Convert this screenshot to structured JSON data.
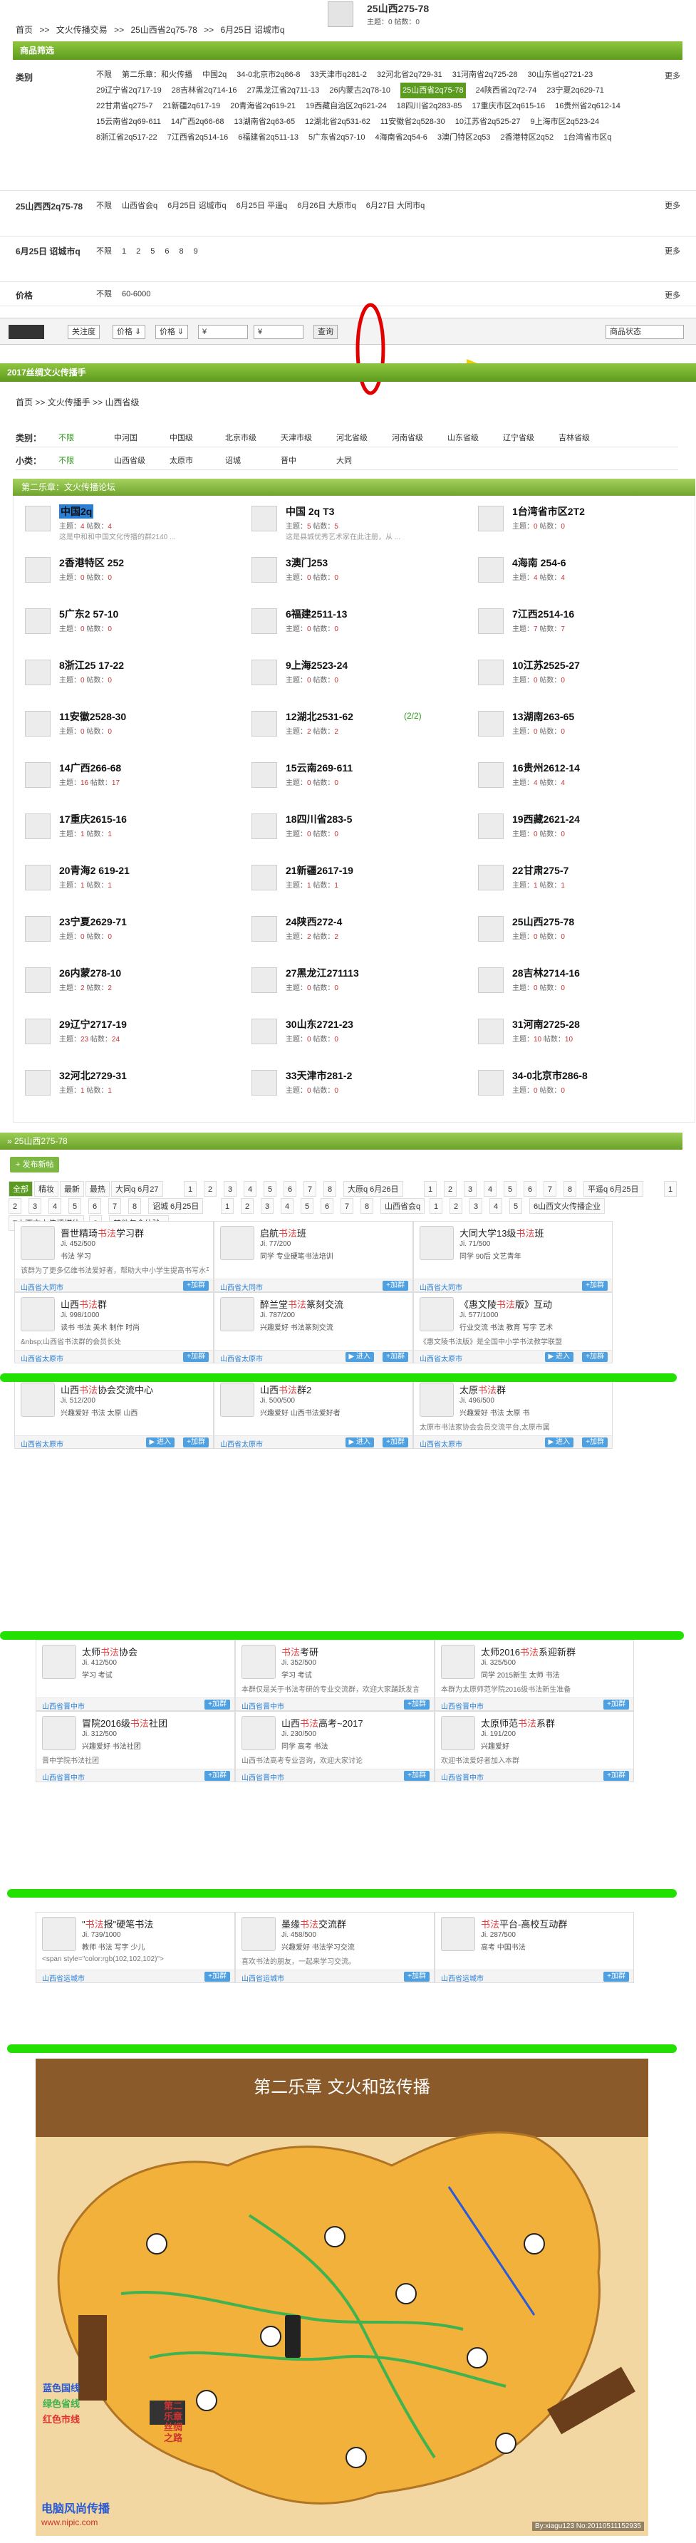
{
  "header": {
    "breadcrumb": [
      "首页",
      ">>",
      "文火传播交易",
      ">>",
      "25山西省2q75-78",
      ">>",
      "6月25日 诏城市q"
    ],
    "title": "25山西275-78",
    "meta": "主题：0   帖数：0"
  },
  "filter": {
    "bar": "商品筛选",
    "category_label": "类别",
    "category_opts": [
      "不限",
      "第二乐章：和火传播",
      "中国2q",
      "34-0北京市2q86-8",
      "33天津市q281-2",
      "32河北省2q729-31",
      "31河南省2q725-28",
      "30山东省q2721-23",
      "29辽宁省2q717-19",
      "28吉林省2q714-16",
      "27黑龙江省2q711-13",
      "26内蒙古2q78-10",
      "25山西省2q75-78",
      "24陕西省2q72-74",
      "23宁夏2q629-71",
      "22甘肃省q275-7",
      "21新疆2q617-19",
      "20青海省2q619-21",
      "19西藏自治区2q621-24",
      "18四川省2q283-85",
      "17重庆市区2q615-16",
      "16贵州省2q612-14",
      "15云南省2q69-611",
      "14广西2q66-68",
      "13湖南省2q63-65",
      "12湖北省2q531-62",
      "11安徽省2q528-30",
      "10江苏省2q525-27",
      "9上海市区2q523-24",
      "8浙江省2q517-22",
      "7江西省2q514-16",
      "6福建省2q511-13",
      "5广东省2q57-10",
      "4海南省2q54-6",
      "3澳门特区2q53",
      "2香港特区2q52",
      "1台湾省市区q"
    ],
    "more": "更多",
    "row2_label": "25山西西2q75-78",
    "row2_opts": [
      "不限",
      "山西省会q",
      "6月25日 诏城市q",
      "6月25日 平遥q",
      "6月26日 大原市q",
      "6月27日 大同市q"
    ],
    "row3_label": "6月25日 诏城市q",
    "row3_opts": [
      "不限",
      "1",
      "2",
      "5",
      "6",
      "8",
      "9"
    ],
    "price_label": "价格",
    "price_opts": [
      "不限",
      "60-6000"
    ]
  },
  "toolbar": {
    "sort": "关注度",
    "price_sort": "价格 ⇓",
    "price2": "价格 ⇓",
    "from": "¥",
    "to": "¥",
    "search": "查询",
    "state": "商品状态"
  },
  "forum": {
    "bar": "2017丝绸文火传播手",
    "breadcrumb": [
      "首页",
      ">>",
      "文火传播手",
      ">>",
      "山西省级"
    ],
    "cat_label": "类别：",
    "cat_opts": [
      "不限",
      "中河国",
      "中国级",
      "北京市级",
      "天津市级",
      "河北省级",
      "河南省级",
      "山东省级",
      "辽宁省级",
      "吉林省级"
    ],
    "sub_label": "小类：",
    "sub_opts": [
      "不限",
      "山西省级",
      "太原市",
      "诏城",
      "晋中",
      "大同"
    ],
    "grid_head": "第二乐章：文火传播论坛",
    "cells": [
      {
        "name": "中国2q",
        "s": "4",
        "p": "4",
        "d": "这是中和和中国文化传播的群2140 ..."
      },
      {
        "name": "中国 2q T3",
        "s": "5",
        "p": "5",
        "d": "这是县城优秀艺术家在此注册，从 ..."
      },
      {
        "name": "1台湾省市区2T2",
        "s": "0",
        "p": "0",
        "d": ""
      },
      {
        "name": "2香港特区 252",
        "s": "0",
        "p": "0",
        "d": ""
      },
      {
        "name": "3澳门253",
        "s": "0",
        "p": "0",
        "d": ""
      },
      {
        "name": "4海南 254-6",
        "s": "4",
        "p": "4",
        "d": ""
      },
      {
        "name": "5广东2 57-10",
        "s": "0",
        "p": "0",
        "d": ""
      },
      {
        "name": "6福建2511-13",
        "s": "0",
        "p": "0",
        "d": ""
      },
      {
        "name": "7江西2514-16",
        "s": "7",
        "p": "7",
        "d": ""
      },
      {
        "name": "8浙江25 17-22",
        "s": "0",
        "p": "0",
        "d": ""
      },
      {
        "name": "9上海2523-24",
        "s": "0",
        "p": "0",
        "d": ""
      },
      {
        "name": "10江苏2525-27",
        "s": "0",
        "p": "0",
        "d": ""
      },
      {
        "name": "11安徽2528-30",
        "s": "0",
        "p": "0",
        "d": ""
      },
      {
        "name": "12湖北2531-62",
        "s": "2",
        "p": "2",
        "d": "",
        "extra": "(2/2)"
      },
      {
        "name": "13湖南263-65",
        "s": "0",
        "p": "0",
        "d": ""
      },
      {
        "name": "14广西266-68",
        "s": "16",
        "p": "17",
        "d": ""
      },
      {
        "name": "15云南269-611",
        "s": "0",
        "p": "0",
        "d": ""
      },
      {
        "name": "16贵州2612-14",
        "s": "4",
        "p": "4",
        "d": ""
      },
      {
        "name": "17重庆2615-16",
        "s": "1",
        "p": "1",
        "d": ""
      },
      {
        "name": "18四川省283-5",
        "s": "0",
        "p": "0",
        "d": ""
      },
      {
        "name": "19西藏2621-24",
        "s": "0",
        "p": "0",
        "d": ""
      },
      {
        "name": "20青海2 619-21",
        "s": "1",
        "p": "1",
        "d": ""
      },
      {
        "name": "21新疆2617-19",
        "s": "1",
        "p": "1",
        "d": ""
      },
      {
        "name": "22甘肃275-7",
        "s": "1",
        "p": "1",
        "d": ""
      },
      {
        "name": "23宁夏2629-71",
        "s": "0",
        "p": "0",
        "d": ""
      },
      {
        "name": "24陕西272-4",
        "s": "2",
        "p": "2",
        "d": ""
      },
      {
        "name": "25山西275-78",
        "s": "0",
        "p": "0",
        "d": ""
      },
      {
        "name": "26内蒙278-10",
        "s": "2",
        "p": "2",
        "d": ""
      },
      {
        "name": "27黑龙江271113",
        "s": "0",
        "p": "0",
        "d": ""
      },
      {
        "name": "28吉林2714-16",
        "s": "0",
        "p": "0",
        "d": ""
      },
      {
        "name": "29辽宁2717-19",
        "s": "23",
        "p": "24",
        "d": ""
      },
      {
        "name": "30山东2721-23",
        "s": "0",
        "p": "0",
        "d": ""
      },
      {
        "name": "31河南2725-28",
        "s": "10",
        "p": "10",
        "d": ""
      },
      {
        "name": "32河北2729-31",
        "s": "1",
        "p": "1",
        "d": ""
      },
      {
        "name": "33天津市281-2",
        "s": "0",
        "p": "0",
        "d": ""
      },
      {
        "name": "34-0北京市286-8",
        "s": "0",
        "p": "0",
        "d": ""
      }
    ],
    "stat_topic": "主题：",
    "stat_post": " 帖数："
  },
  "groups": {
    "head": "» 25山西275-78",
    "post_btn": "+ 发布新帖",
    "tags": [
      "全部",
      "精妆",
      "最新",
      "最热",
      "大同q 6月27",
      "1",
      "2",
      "3",
      "4",
      "5",
      "6",
      "7",
      "8",
      "大原q 6月26日",
      "1",
      "2",
      "3",
      "4",
      "5",
      "6",
      "7",
      "8",
      "平遥q 6月25日",
      "1",
      "2",
      "3",
      "4",
      "5",
      "6",
      "7",
      "8",
      "诏城 6月25日",
      "1",
      "2",
      "3",
      "4",
      "5",
      "6",
      "7",
      "8",
      "山西省会q",
      "1",
      "2",
      "3",
      "4",
      "5",
      "6山西文火传播企业",
      "7山西文火传播媒体",
      "8",
      "其他包含体验q"
    ],
    "rows": [
      [
        {
          "n1": "晋世精琦",
          "n2": "书法",
          "n3": "学习群",
          "m": "Ji. 452/500",
          "t": "书法  学习",
          "d": "该群为了更多亿维书法爱好者，帮助大中小学生提高书写水平，利用网络便利随时随地学生业的书写...",
          "loc": "山西省大同市"
        },
        {
          "n1": "启航",
          "n2": "书法",
          "n3": "班",
          "m": "Ji. 77/200",
          "t": "同学  专业硬笔书法培训",
          "d": "",
          "loc": "山西省大同市"
        },
        {
          "n1": "大同大学13级",
          "n2": "书法",
          "n3": "班",
          "m": "Ji. 71/500",
          "t": "同学  90后  文艺青年",
          "d": "",
          "loc": "山西省大同市"
        }
      ],
      [
        {
          "n1": "山西",
          "n2": "书法",
          "n3": "群",
          "m": "Ji. 998/1000",
          "t": "读书  书法  美术  制作  时尚",
          "d": "&nbsp;山西省书法群的会员长处",
          "loc": "山西省太原市"
        },
        {
          "n1": "醉兰堂",
          "n2": "书法",
          "n3": "篆刻交流",
          "m": "Ji. 787/200",
          "t": "兴趣爱好  书法篆刻交流",
          "d": "",
          "loc": "山西省太原市"
        },
        {
          "n1": "《惠文陵",
          "n2": "书法",
          "n3": "版》互动",
          "m": "Ji. 577/1000",
          "t": "行业交流  书法  教育  写字  艺术",
          "d": "《惠文陵书法版》是全国中小学书法教学联盟",
          "loc": "山西省太原市"
        }
      ],
      [
        {
          "n1": "山西",
          "n2": "书法",
          "n3": "协会交流中心",
          "m": "Ji. 512/200",
          "t": "兴趣爱好  书法  太原  山西",
          "d": "",
          "loc": "山西省太原市"
        },
        {
          "n1": "山西",
          "n2": "书法",
          "n3": "群2",
          "m": "Ji. 500/500",
          "t": "兴趣爱好  山西书法爱好者",
          "d": "",
          "loc": "山西省太原市"
        },
        {
          "n1": "太原",
          "n2": "书法",
          "n3": "群",
          "m": "Ji. 496/500",
          "t": "兴趣爱好  书法  太原  书",
          "d": "太原市书法家协会会员交流平台,太原市属",
          "loc": "山西省太原市"
        }
      ],
      [
        {
          "n1": "太师",
          "n2": "书法",
          "n3": "协会",
          "m": "Ji. 412/500",
          "t": "学习  考试",
          "d": "",
          "loc": "山西省晋中市"
        },
        {
          "n1": "",
          "n2": "书法",
          "n3": "考研",
          "m": "Ji. 352/500",
          "t": "学习  考试",
          "d": "本群仅是关于书法考研的专业交流群，欢迎大家踊跃发言",
          "loc": "山西省晋中市"
        },
        {
          "n1": "太师2016",
          "n2": "书法",
          "n3": "系迎新群",
          "m": "Ji. 325/500",
          "t": "同学  2015新生  太师  书法",
          "d": "本群为太原师范学院2016级书法新生准备",
          "loc": "山西省晋中市"
        }
      ],
      [
        {
          "n1": "冒院2016级",
          "n2": "书法",
          "n3": "社团",
          "m": "Ji. 312/500",
          "t": "兴趣爱好  书法社团",
          "d": "晋中学院书法社团",
          "loc": "山西省晋中市"
        },
        {
          "n1": "山西",
          "n2": "书法",
          "n3": "高考~2017",
          "m": "Ji. 230/500",
          "t": "同学  高考  书法",
          "d": "山西书法高考专业咨询，欢迎大家讨论",
          "loc": "山西省晋中市"
        },
        {
          "n1": "太原师范",
          "n2": "书法",
          "n3": "系群",
          "m": "Ji. 191/200",
          "t": "兴趣爱好",
          "d": "欢迎书法爱好者加入本群",
          "loc": "山西省晋中市"
        }
      ],
      [
        {
          "n1": "\"",
          "n2": "书法",
          "n3": "报\"硬笔书法",
          "m": "Ji. 739/1000",
          "t": "教师  书法  写字  少儿",
          "d": "<span style=\"color:rgb(102,102,102)\">",
          "loc": "山西省运城市"
        },
        {
          "n1": "墨缘",
          "n2": "书法",
          "n3": "交流群",
          "m": "Ji. 458/500",
          "t": "兴趣爱好  书法学习交流",
          "d": "喜欢书法的朋友，一起来学习交流。",
          "loc": "山西省运城市"
        },
        {
          "n1": "",
          "n2": "书法",
          "n3": "平台-高校互动群",
          "m": "Ji. 287/500",
          "t": "高考  中国书法",
          "d": "",
          "loc": "山西省运城市"
        }
      ]
    ],
    "join": "+加群",
    "enter": "▶ 进入"
  },
  "poster": {
    "title": "第二乐章  文火和弦传播",
    "legend": [
      "蓝色国线",
      "绿色省线",
      "红色市线"
    ],
    "side": "第二乐章 丝绸之路",
    "footer_left": "电脑风尚传播",
    "footer_site": "www.nipic.com",
    "footer_right": "By:xiagu123  No:20110511152935"
  }
}
